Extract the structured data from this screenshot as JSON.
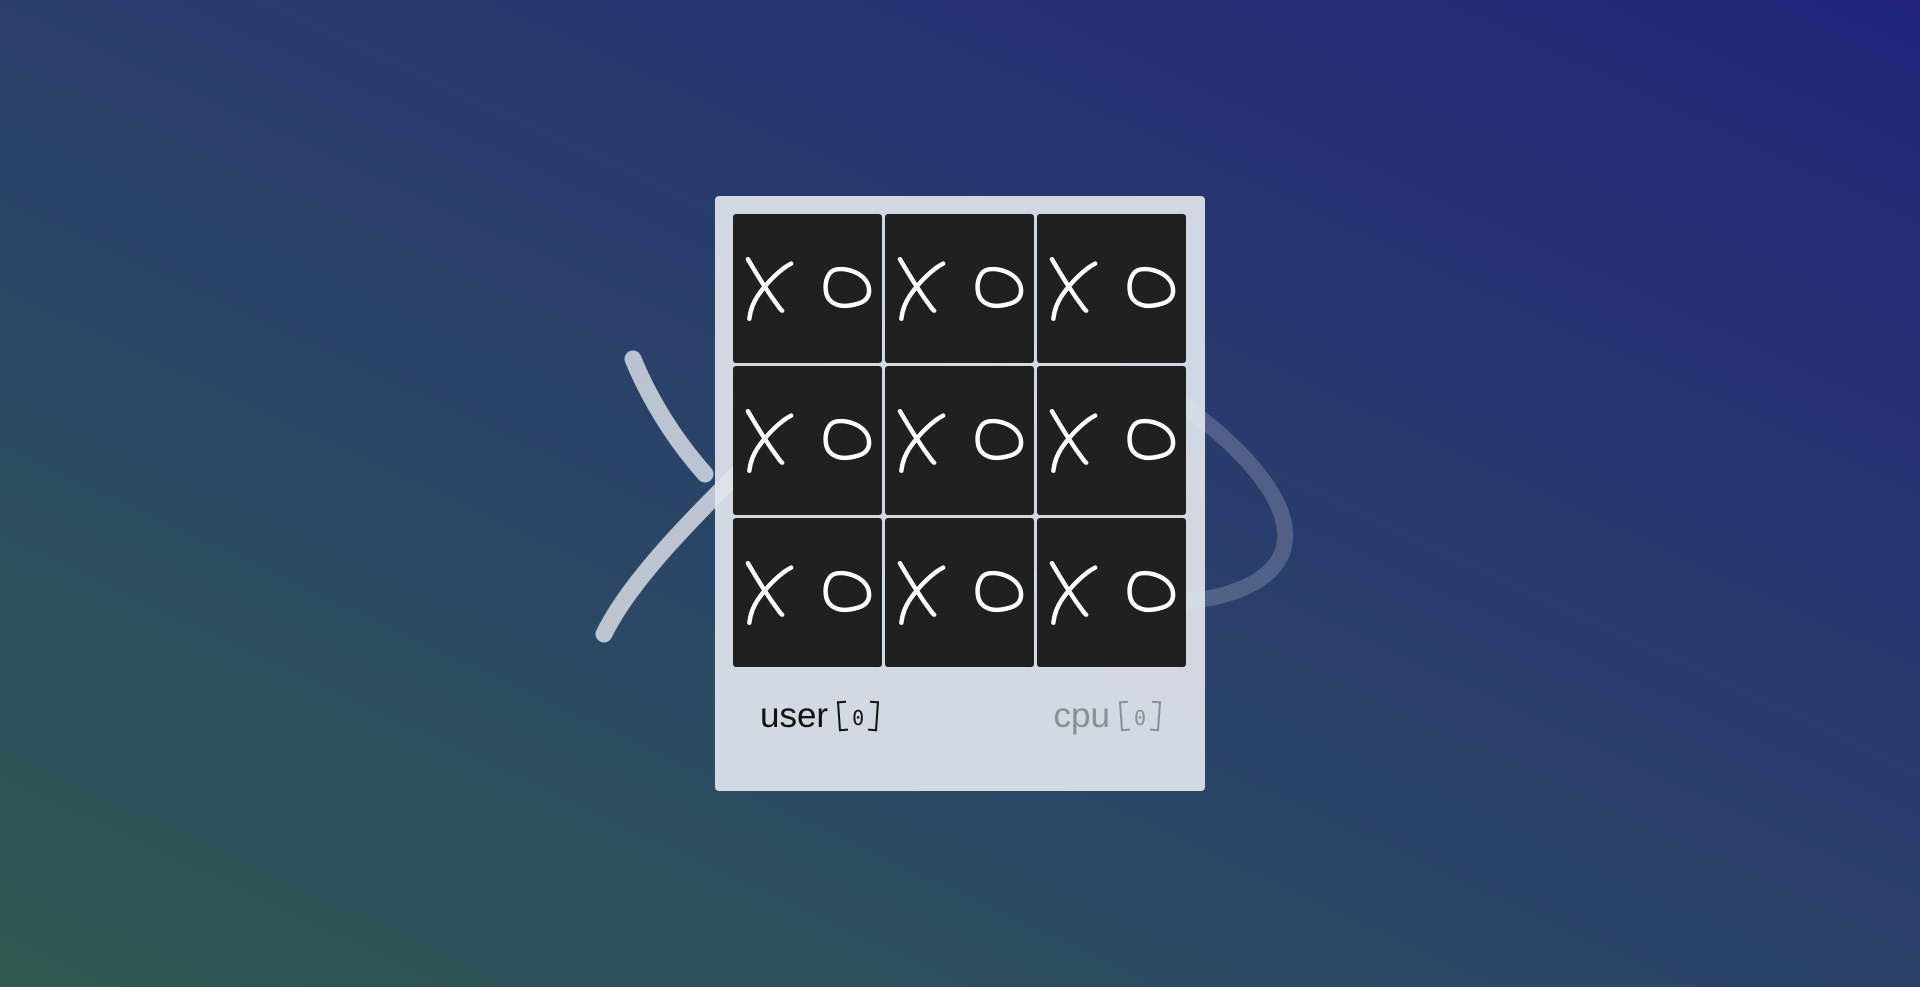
{
  "theme": {
    "panel_color": "#e0e4ea",
    "cell_color": "#202020",
    "mark_color": "#ffffff",
    "active_color": "#111111",
    "inactive_color": "#8a8f96"
  },
  "board": {
    "cells": [
      "X",
      "O",
      "",
      "O",
      "O",
      "X",
      "X",
      "",
      ""
    ]
  },
  "scoreboard": {
    "user": {
      "label": "user",
      "score": "0",
      "active": true
    },
    "cpu": {
      "label": "cpu",
      "score": "0",
      "active": false
    }
  }
}
